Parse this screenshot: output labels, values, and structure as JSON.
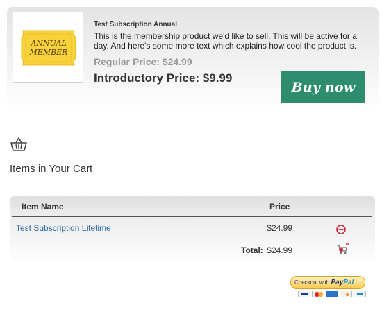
{
  "product": {
    "title": "Test Subscription Annual",
    "description": "This is the membership product we'd like to sell. This will be active for a day. And here's some more text which explains how cool the product is.",
    "regular_price": "Regular Price: $24.99",
    "intro_price": "Introductory Price: $9.99",
    "buy_label": "Buy now",
    "badge_line1": "ANNUAL",
    "badge_line2": "MEMBER"
  },
  "cart": {
    "heading": "Items in Your Cart",
    "columns": {
      "item": "Item Name",
      "price": "Price"
    },
    "rows": [
      {
        "name": "Test Subscription Lifetime",
        "price": "$24.99"
      }
    ],
    "total_label": "Total:",
    "total_value": "$24.99"
  },
  "paypal": {
    "checkout_text": "Checkout with",
    "brand_pay": "Pay",
    "brand_pal": "Pal"
  },
  "colors": {
    "buy_button": "#2f8d6f",
    "link": "#2a6aa0",
    "remove": "#d0263a",
    "badge": "#f7d23a"
  },
  "icons": {
    "basket": "basket-icon",
    "remove": "remove-minus-circle-icon",
    "cart": "cart-remove-icon"
  }
}
